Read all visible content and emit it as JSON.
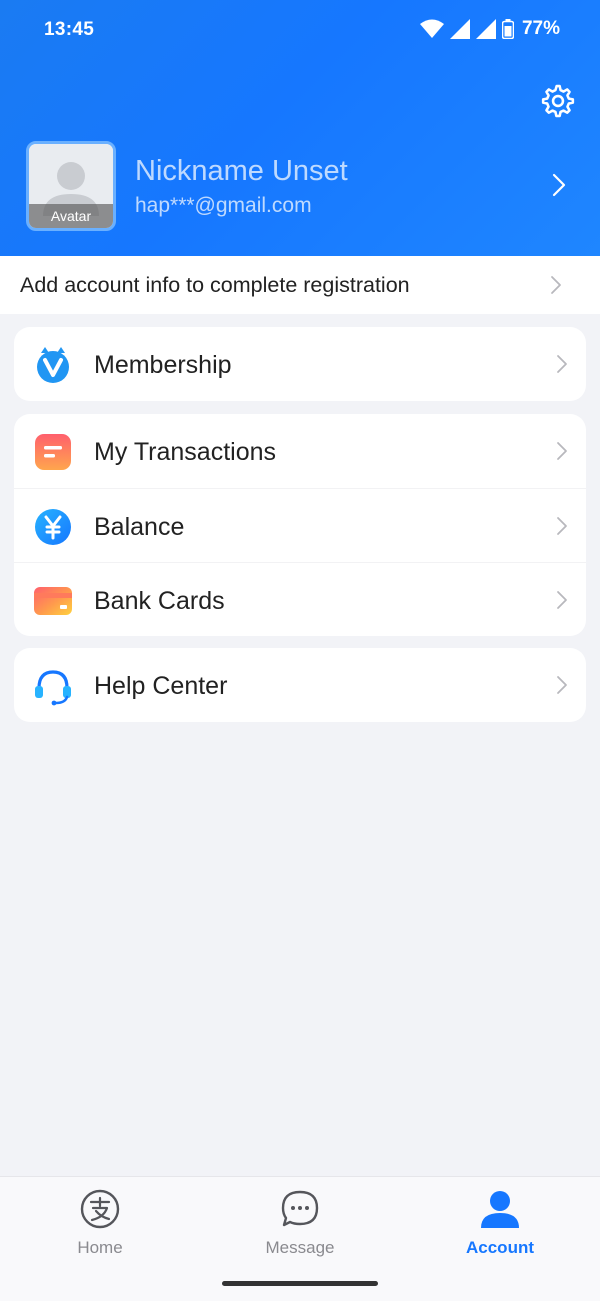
{
  "status_bar": {
    "time": "13:45",
    "battery": "77%"
  },
  "profile": {
    "avatar_label": "Avatar",
    "nickname": "Nickname Unset",
    "email": "hap***@gmail.com"
  },
  "registration": {
    "text": "Add account info to complete registration"
  },
  "menu": {
    "membership": {
      "label": "Membership",
      "icon": "membership-v-icon"
    },
    "transactions": {
      "label": "My Transactions",
      "icon": "transactions-list-icon"
    },
    "balance": {
      "label": "Balance",
      "icon": "yuan-coin-icon"
    },
    "bank_cards": {
      "label": "Bank Cards",
      "icon": "bank-card-icon"
    },
    "help_center": {
      "label": "Help Center",
      "icon": "headset-icon"
    }
  },
  "bottom_nav": {
    "items": [
      {
        "label": "Home",
        "icon": "alipay-logo-icon",
        "active": false
      },
      {
        "label": "Message",
        "icon": "chat-bubble-icon",
        "active": false
      },
      {
        "label": "Account",
        "icon": "person-icon",
        "active": true
      }
    ]
  },
  "colors": {
    "primary": "#1677ff",
    "background": "#f2f3f7",
    "inactive_nav": "#8a8a8f"
  }
}
